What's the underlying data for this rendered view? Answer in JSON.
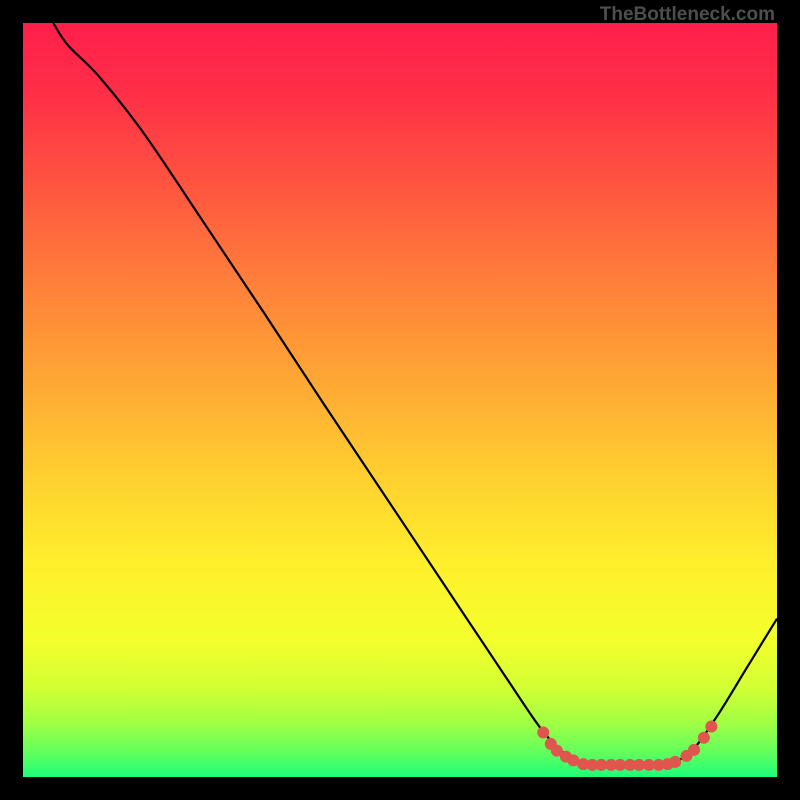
{
  "watermark": "TheBottleneck.com",
  "chart_data": {
    "type": "line",
    "x_range": [
      0,
      100
    ],
    "y_range": [
      0,
      100
    ],
    "curve": [
      {
        "x": 4.0,
        "y": 100.0
      },
      {
        "x": 6.0,
        "y": 97.0
      },
      {
        "x": 10.0,
        "y": 93.0
      },
      {
        "x": 16.0,
        "y": 85.4
      },
      {
        "x": 24.0,
        "y": 73.5
      },
      {
        "x": 32.0,
        "y": 61.5
      },
      {
        "x": 40.0,
        "y": 49.3
      },
      {
        "x": 48.0,
        "y": 37.3
      },
      {
        "x": 56.0,
        "y": 25.3
      },
      {
        "x": 64.0,
        "y": 13.3
      },
      {
        "x": 69.0,
        "y": 6.0
      },
      {
        "x": 72.5,
        "y": 2.6
      },
      {
        "x": 75.0,
        "y": 1.6
      },
      {
        "x": 80.0,
        "y": 1.6
      },
      {
        "x": 85.0,
        "y": 1.6
      },
      {
        "x": 88.5,
        "y": 3.3
      },
      {
        "x": 92.0,
        "y": 8.0
      },
      {
        "x": 96.0,
        "y": 14.5
      },
      {
        "x": 100.0,
        "y": 21.0
      }
    ],
    "highlight_dots": [
      {
        "x": 69.0,
        "y": 5.9
      },
      {
        "x": 70.0,
        "y": 4.4
      },
      {
        "x": 70.8,
        "y": 3.5
      },
      {
        "x": 72.0,
        "y": 2.7
      },
      {
        "x": 73.0,
        "y": 2.2
      },
      {
        "x": 74.3,
        "y": 1.7
      },
      {
        "x": 75.5,
        "y": 1.6
      },
      {
        "x": 76.7,
        "y": 1.6
      },
      {
        "x": 78.0,
        "y": 1.6
      },
      {
        "x": 79.2,
        "y": 1.6
      },
      {
        "x": 80.5,
        "y": 1.6
      },
      {
        "x": 81.7,
        "y": 1.6
      },
      {
        "x": 83.0,
        "y": 1.6
      },
      {
        "x": 84.3,
        "y": 1.6
      },
      {
        "x": 85.5,
        "y": 1.7
      },
      {
        "x": 86.5,
        "y": 2.0
      },
      {
        "x": 88.0,
        "y": 2.8
      },
      {
        "x": 89.0,
        "y": 3.6
      },
      {
        "x": 90.3,
        "y": 5.2
      },
      {
        "x": 91.3,
        "y": 6.7
      }
    ],
    "gradient_stops": [
      {
        "offset": 0.0,
        "color": "#ff1f4a"
      },
      {
        "offset": 0.09,
        "color": "#ff2e48"
      },
      {
        "offset": 0.2,
        "color": "#ff5041"
      },
      {
        "offset": 0.33,
        "color": "#ff7b3b"
      },
      {
        "offset": 0.47,
        "color": "#ffa635"
      },
      {
        "offset": 0.6,
        "color": "#ffcf30"
      },
      {
        "offset": 0.72,
        "color": "#fff02c"
      },
      {
        "offset": 0.82,
        "color": "#f3ff2c"
      },
      {
        "offset": 0.88,
        "color": "#d3ff33"
      },
      {
        "offset": 0.93,
        "color": "#9fff45"
      },
      {
        "offset": 0.97,
        "color": "#5dff5f"
      },
      {
        "offset": 1.0,
        "color": "#1bff7a"
      }
    ],
    "curve_color": "#000000",
    "dot_color": "#e0554e",
    "dot_radius_px": 6
  }
}
